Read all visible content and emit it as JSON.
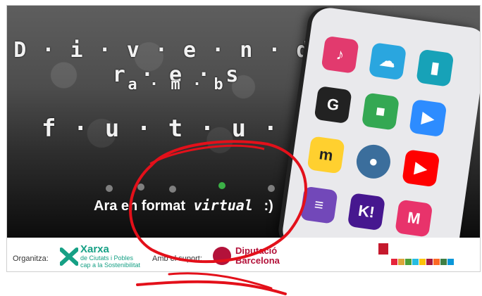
{
  "title": {
    "line1": "D · i · v · e · n · d · r · e · s",
    "line2": "a · m · b",
    "line3": "f · u · t · u · r"
  },
  "tagline": {
    "prefix": "Ara en format",
    "emphasis": "virtual",
    "suffix": ":)"
  },
  "apps": [
    {
      "name": "kahoot-like-icon",
      "color": "#e23a6e",
      "glyph": "♪"
    },
    {
      "name": "anatomy-icon",
      "color": "#2aa6df",
      "glyph": "☁"
    },
    {
      "name": "analytics-icon",
      "color": "#17a2b8",
      "glyph": "▮"
    },
    {
      "name": "genially-icon",
      "color": "#222222",
      "glyph": "G"
    },
    {
      "name": "meet-icon",
      "color": "#34a853",
      "glyph": "■"
    },
    {
      "name": "zoom-icon",
      "color": "#2d8cff",
      "glyph": "▶"
    },
    {
      "name": "miro-icon",
      "color": "#ffd02f",
      "glyph": "m"
    },
    {
      "name": "earth-icon",
      "color": "#3b6e9c",
      "glyph": "●"
    },
    {
      "name": "youtube-icon",
      "color": "#ff0000",
      "glyph": "▶"
    },
    {
      "name": "forms-icon",
      "color": "#7248b9",
      "glyph": "≡"
    },
    {
      "name": "kahoot-icon",
      "color": "#46178f",
      "glyph": "K!"
    },
    {
      "name": "mentimeter-icon",
      "color": "#e8336b",
      "glyph": "M"
    }
  ],
  "footer": {
    "organizer_label": "Organitza:",
    "xarxa_name": "Xarxa",
    "xarxa_sub1": "de Ciutats i Pobles",
    "xarxa_sub2": "cap a la Sostenibilitat",
    "support_label": "Amb el suport:",
    "diputacio_line1": "Diputació",
    "diputacio_line2": "Barcelona"
  },
  "colors": {
    "annotation": "#e3101a",
    "xarxa": "#16a085",
    "diputacio": "#b3123a"
  }
}
